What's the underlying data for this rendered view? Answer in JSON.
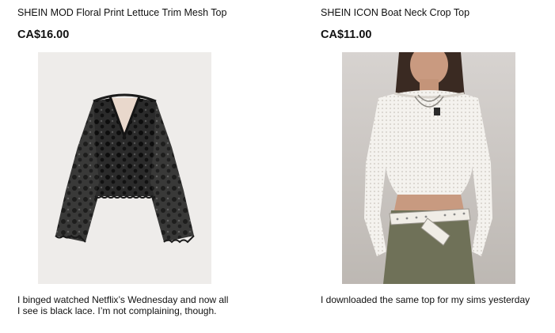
{
  "products": [
    {
      "title": "SHEIN MOD Floral Print Lettuce Trim Mesh Top",
      "price": "CA$16.00",
      "caption_line1": "I binged watched Netflix’s Wednesday and now all",
      "caption_line2": "I see is black lace. I’m not complaining, though."
    },
    {
      "title": "SHEIN ICON Boat Neck Crop Top",
      "price": "CA$11.00",
      "caption_line1": "I downloaded the same top for my sims yesterday"
    }
  ]
}
